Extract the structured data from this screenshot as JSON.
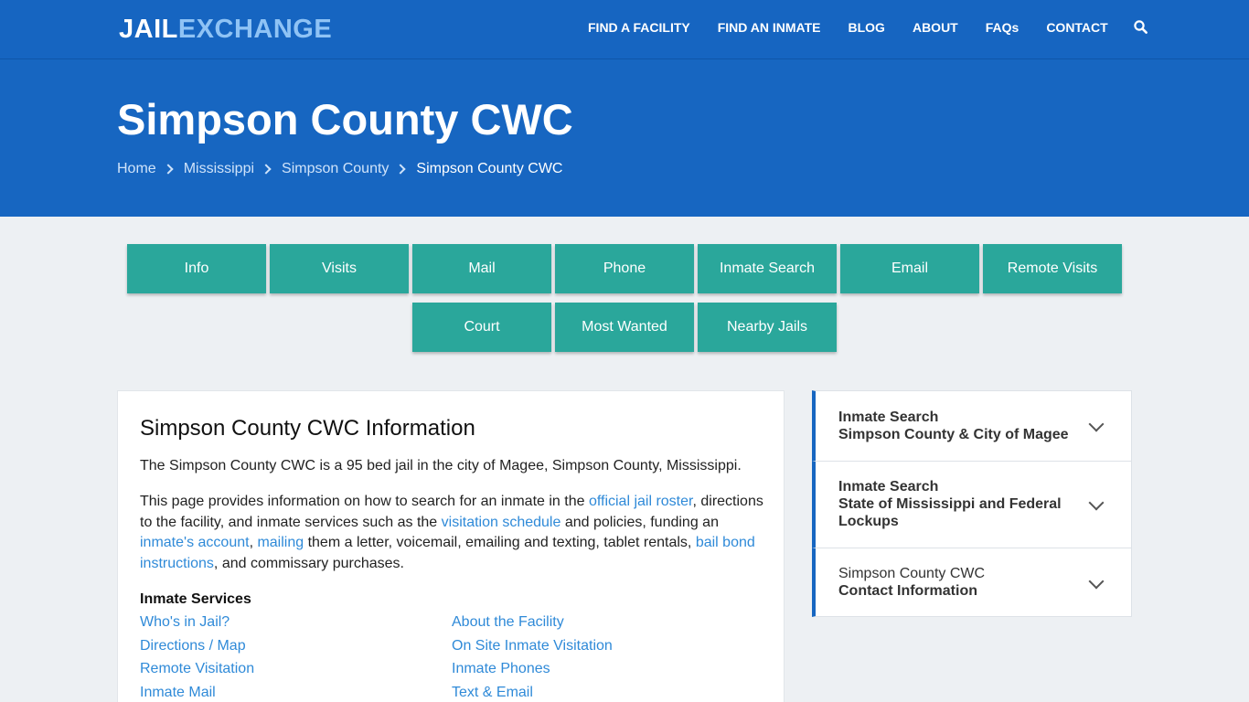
{
  "logo": {
    "part1": "JAIL",
    "part2": "EXCHANGE"
  },
  "nav": {
    "items": [
      "FIND A FACILITY",
      "FIND AN INMATE",
      "BLOG",
      "ABOUT",
      "FAQs",
      "CONTACT"
    ],
    "search_icon": "search-icon"
  },
  "hero": {
    "title": "Simpson County CWC",
    "breadcrumb": [
      "Home",
      "Mississippi",
      "Simpson County",
      "Simpson County CWC"
    ]
  },
  "tabs": {
    "row1": [
      "Info",
      "Visits",
      "Mail",
      "Phone",
      "Inmate Search",
      "Email",
      "Remote Visits"
    ],
    "row2": [
      "Court",
      "Most Wanted",
      "Nearby Jails"
    ]
  },
  "main": {
    "heading": "Simpson County CWC Information",
    "intro": "The Simpson County CWC is a 95 bed jail in the city of Magee, Simpson County, Mississippi.",
    "para": {
      "t1": "This page provides information on how to search for an inmate in the ",
      "l1": "official jail roster",
      "t2": ", directions to the facility, and inmate services such as the ",
      "l2": "visitation schedule",
      "t3": " and policies, funding an ",
      "l3": "inmate's account",
      "t4": ", ",
      "l4": "mailing",
      "t5": " them a letter, voicemail, emailing and texting, tablet rentals, ",
      "l5": "bail bond instructions",
      "t6": ", and commissary purchases."
    },
    "services_heading": "Inmate Services",
    "services_left": [
      "Who's in Jail?",
      "Directions / Map",
      "Remote Visitation",
      "Inmate Mail"
    ],
    "services_right": [
      "About the Facility",
      "On Site Inmate Visitation",
      "Inmate Phones",
      "Text & Email"
    ]
  },
  "sidebar": [
    {
      "line1": "Inmate Search",
      "line2": "Simpson County & City of Magee",
      "line3": ""
    },
    {
      "line1": "Inmate Search",
      "line2": "State of Mississippi and Federal",
      "line3": "Lockups"
    },
    {
      "line1": "Simpson County CWC",
      "line2": "Contact Information",
      "line3": ""
    }
  ],
  "colors": {
    "header_blue": "#1665c1",
    "tab_teal": "#2aa79b",
    "link_blue": "#2f8ad8"
  }
}
